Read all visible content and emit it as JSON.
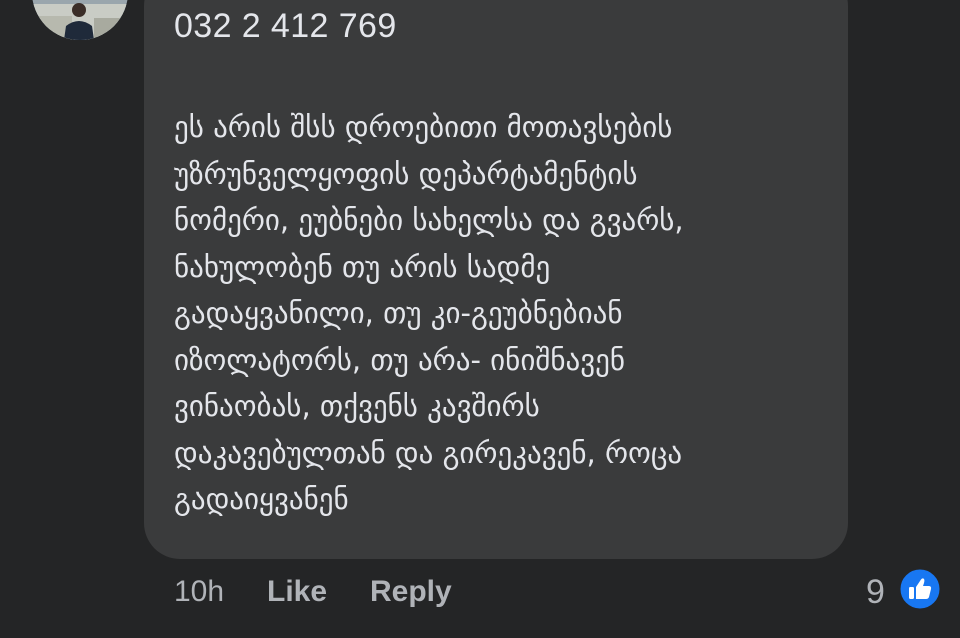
{
  "comment": {
    "phone_number": "032 2 412 769",
    "message_lines": [
      "ეს არის შსს დროებითი მოთავსების",
      "უზრუნველყოფის დეპარტამენტის",
      "ნომერი, ეუბნები სახელსა და გვარს,",
      "ნახულობენ თუ არის სადმე",
      "გადაყვანილი, თუ კი-გეუბნებიან",
      "იზოლატორს, თუ არა- ინიშნავენ",
      "ვინაობას, თქვენს კავშირს",
      "დაკავებულთან და გირეკავენ, როცა",
      "გადაიყვანენ"
    ]
  },
  "actions": {
    "time": "10h",
    "like_label": "Like",
    "reply_label": "Reply",
    "reaction_count": "9"
  },
  "icons": {
    "reaction": "thumbs-up-icon",
    "reaction_color": "#1877f2"
  },
  "colors": {
    "background": "#242526",
    "bubble": "#3a3b3c",
    "text": "#e4e6eb",
    "secondary_text": "#b0b3b8"
  }
}
